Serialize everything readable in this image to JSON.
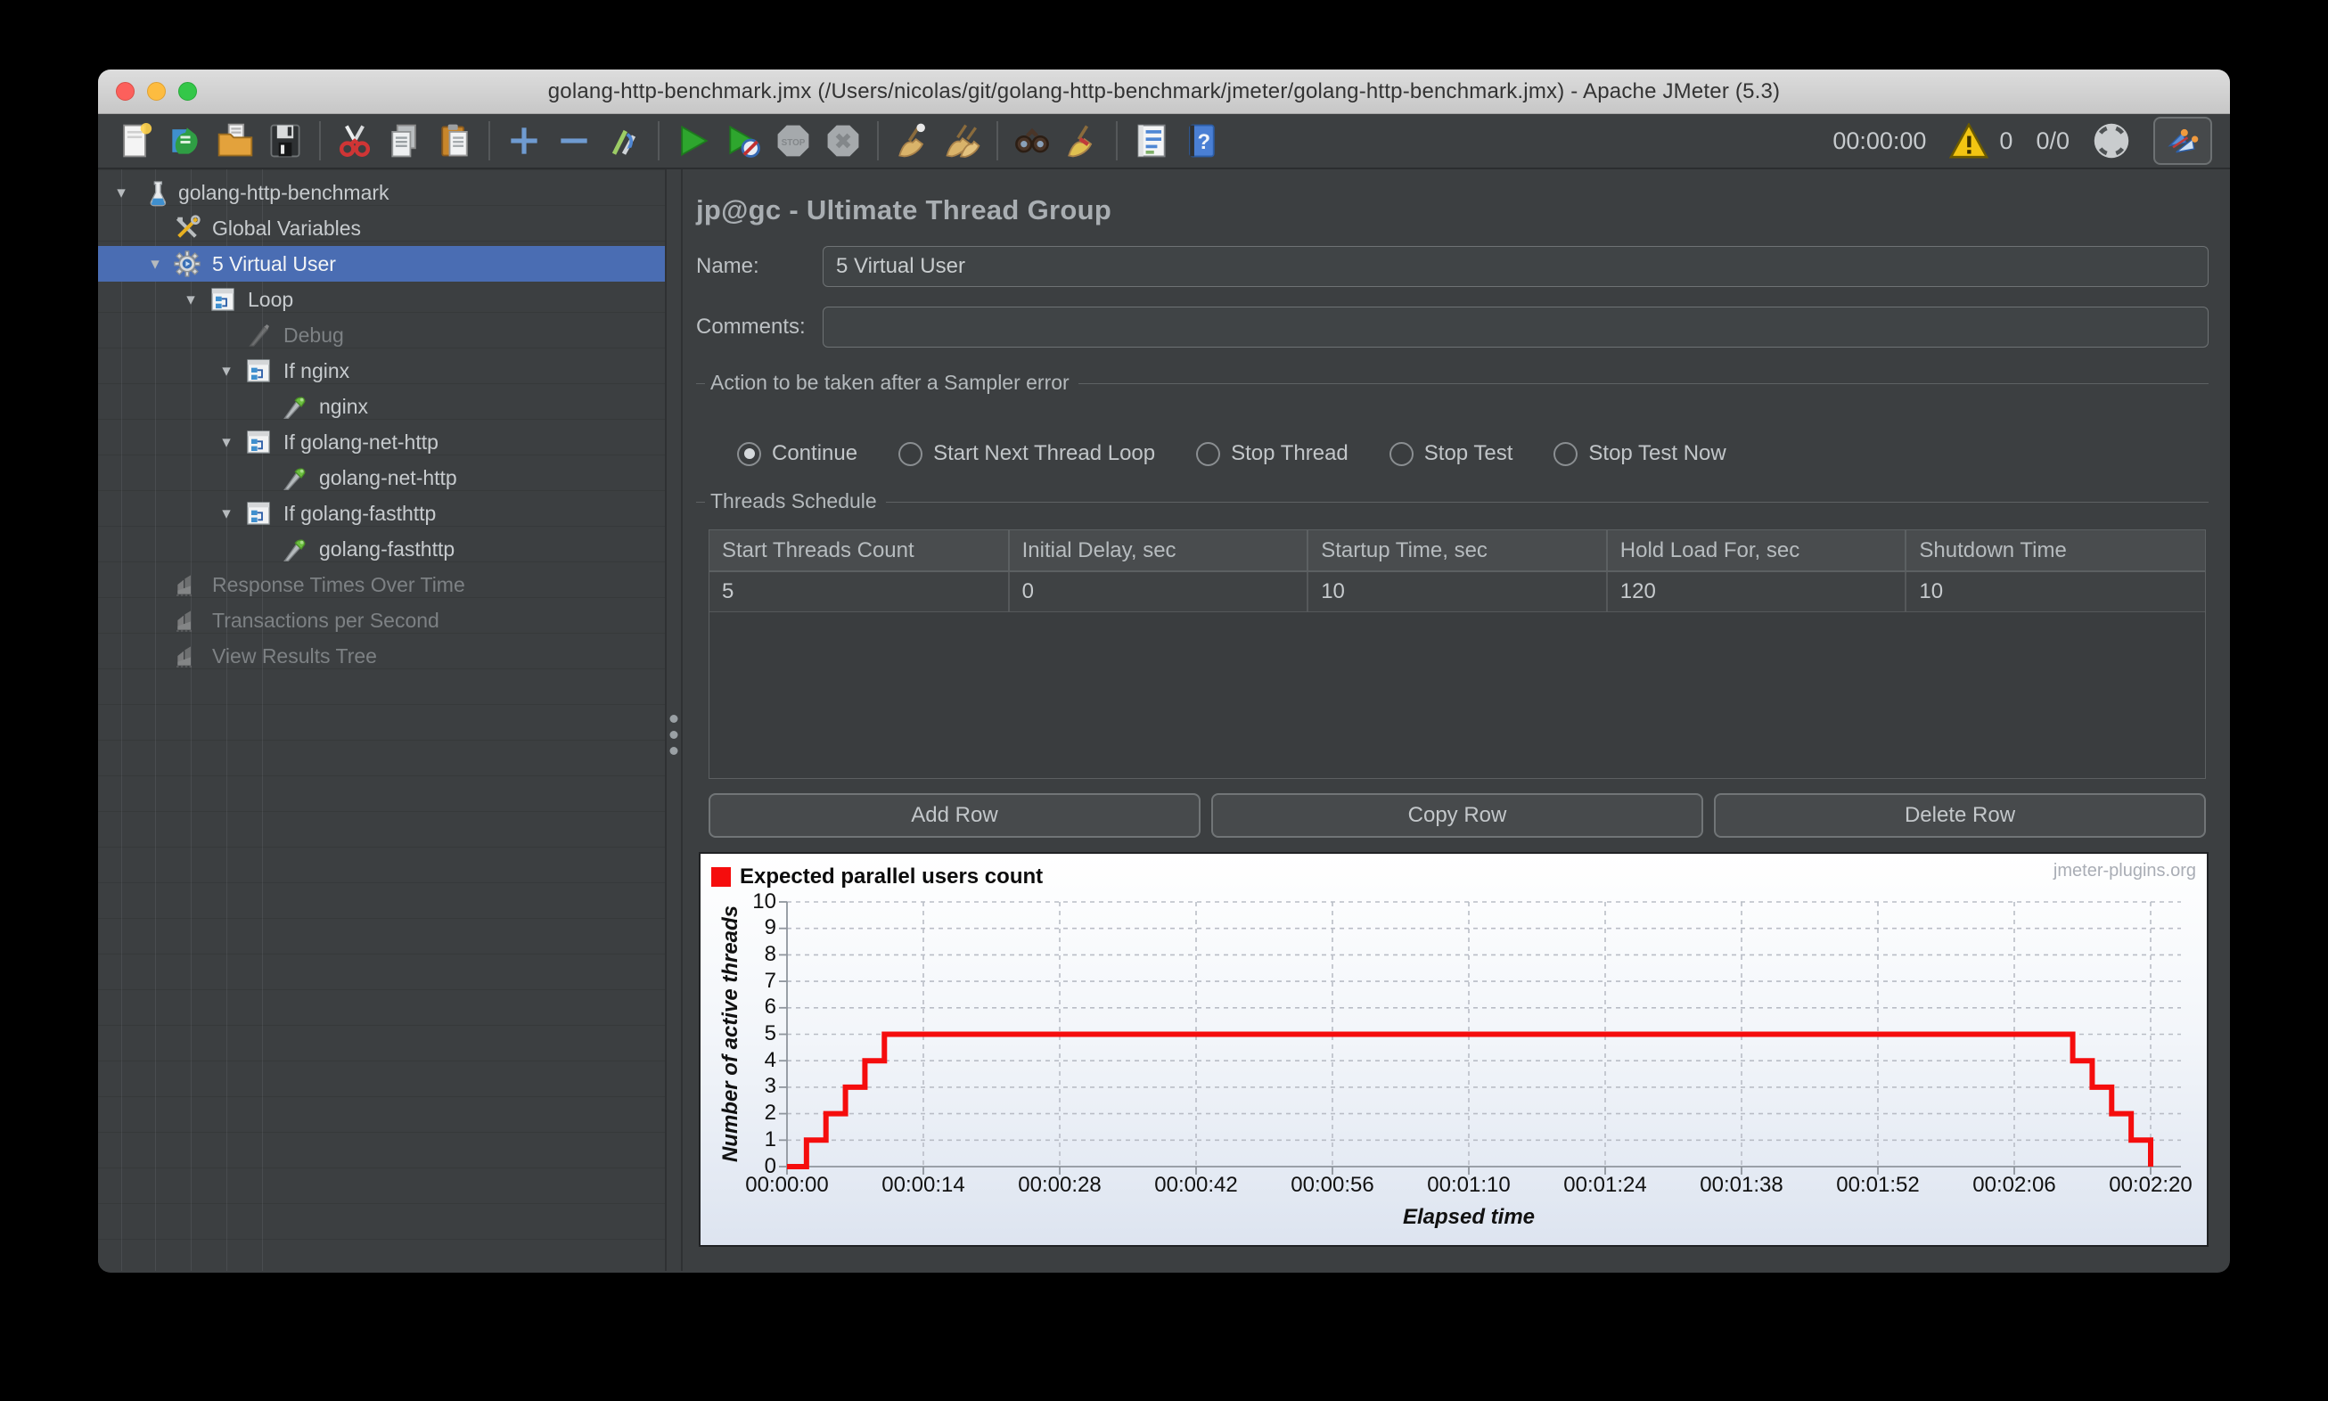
{
  "window": {
    "title": "golang-http-benchmark.jmx (/Users/nicolas/git/golang-http-benchmark/jmeter/golang-http-benchmark.jmx) - Apache JMeter (5.3)"
  },
  "toolbar": {
    "groups": [
      [
        "new-file",
        "templates",
        "open-file",
        "save"
      ],
      [
        "cut",
        "copy",
        "paste"
      ],
      [
        "expand-all",
        "collapse-all",
        "toggle"
      ],
      [
        "start",
        "start-no-pauses",
        "stop",
        "shutdown"
      ],
      [
        "clear",
        "clear-all"
      ],
      [
        "search",
        "reset-search"
      ],
      [
        "function-helper",
        "help"
      ]
    ],
    "timer": "00:00:00",
    "warning_count": "0",
    "threads_ratio": "0/0"
  },
  "tree": {
    "items": [
      {
        "label": "golang-http-benchmark",
        "icon": "test-plan",
        "level": 0,
        "expanded": true,
        "selected": false,
        "disabled": false
      },
      {
        "label": "Global Variables",
        "icon": "config-tools",
        "level": 1,
        "expanded": null,
        "selected": false,
        "disabled": false
      },
      {
        "label": "5 Virtual User",
        "icon": "thread-group-gear",
        "level": 1,
        "expanded": true,
        "selected": true,
        "disabled": false
      },
      {
        "label": "Loop",
        "icon": "controller",
        "level": 2,
        "expanded": true,
        "selected": false,
        "disabled": false
      },
      {
        "label": "Debug",
        "icon": "debug-sampler",
        "level": 3,
        "expanded": null,
        "selected": false,
        "disabled": true
      },
      {
        "label": "If nginx",
        "icon": "controller",
        "level": 3,
        "expanded": true,
        "selected": false,
        "disabled": false
      },
      {
        "label": "nginx",
        "icon": "sampler",
        "level": 4,
        "expanded": null,
        "selected": false,
        "disabled": false
      },
      {
        "label": "If golang-net-http",
        "icon": "controller",
        "level": 3,
        "expanded": true,
        "selected": false,
        "disabled": false
      },
      {
        "label": "golang-net-http",
        "icon": "sampler",
        "level": 4,
        "expanded": null,
        "selected": false,
        "disabled": false
      },
      {
        "label": "If golang-fasthttp",
        "icon": "controller",
        "level": 3,
        "expanded": true,
        "selected": false,
        "disabled": false
      },
      {
        "label": "golang-fasthttp",
        "icon": "sampler",
        "level": 4,
        "expanded": null,
        "selected": false,
        "disabled": false
      },
      {
        "label": "Response Times Over Time",
        "icon": "listener-chart",
        "level": 1,
        "expanded": null,
        "selected": false,
        "disabled": true
      },
      {
        "label": "Transactions per Second",
        "icon": "listener-chart",
        "level": 1,
        "expanded": null,
        "selected": false,
        "disabled": true
      },
      {
        "label": "View Results Tree",
        "icon": "listener-chart",
        "level": 1,
        "expanded": null,
        "selected": false,
        "disabled": true
      }
    ]
  },
  "panel": {
    "title": "jp@gc - Ultimate Thread Group",
    "name_label": "Name:",
    "name_value": "5 Virtual User",
    "comments_label": "Comments:",
    "comments_value": "",
    "error_action": {
      "legend": "Action to be taken after a Sampler error",
      "options": [
        {
          "label": "Continue",
          "selected": true
        },
        {
          "label": "Start Next Thread Loop",
          "selected": false
        },
        {
          "label": "Stop Thread",
          "selected": false
        },
        {
          "label": "Stop Test",
          "selected": false
        },
        {
          "label": "Stop Test Now",
          "selected": false
        }
      ]
    },
    "schedule": {
      "legend": "Threads Schedule",
      "columns": [
        "Start Threads Count",
        "Initial Delay, sec",
        "Startup Time, sec",
        "Hold Load For, sec",
        "Shutdown Time"
      ],
      "rows": [
        [
          "5",
          "0",
          "10",
          "120",
          "10"
        ]
      ]
    },
    "buttons": [
      "Add Row",
      "Copy Row",
      "Delete Row"
    ]
  },
  "chart_data": {
    "type": "line",
    "step": true,
    "legend_label": "Expected parallel users count",
    "legend_position": "top-left",
    "series_color": "#f50d0d",
    "watermark": "jmeter-plugins.org",
    "xlabel": "Elapsed time",
    "ylabel": "Number of active threads",
    "ylim": [
      0,
      10
    ],
    "y_ticks": [
      0,
      1,
      2,
      3,
      4,
      5,
      6,
      7,
      8,
      9,
      10
    ],
    "x_tick_seconds": [
      0,
      14,
      28,
      42,
      56,
      70,
      84,
      98,
      112,
      126,
      140
    ],
    "x_tick_labels": [
      "00:00:00",
      "00:00:14",
      "00:00:28",
      "00:00:42",
      "00:00:56",
      "00:01:10",
      "00:01:24",
      "00:01:38",
      "00:01:52",
      "00:02:06",
      "00:02:20"
    ],
    "grid": "dashed",
    "points": [
      [
        0,
        0
      ],
      [
        2,
        1
      ],
      [
        4,
        2
      ],
      [
        6,
        3
      ],
      [
        8,
        4
      ],
      [
        10,
        5
      ],
      [
        130,
        5
      ],
      [
        132,
        4
      ],
      [
        134,
        3
      ],
      [
        136,
        2
      ],
      [
        138,
        1
      ],
      [
        140,
        0
      ]
    ]
  }
}
